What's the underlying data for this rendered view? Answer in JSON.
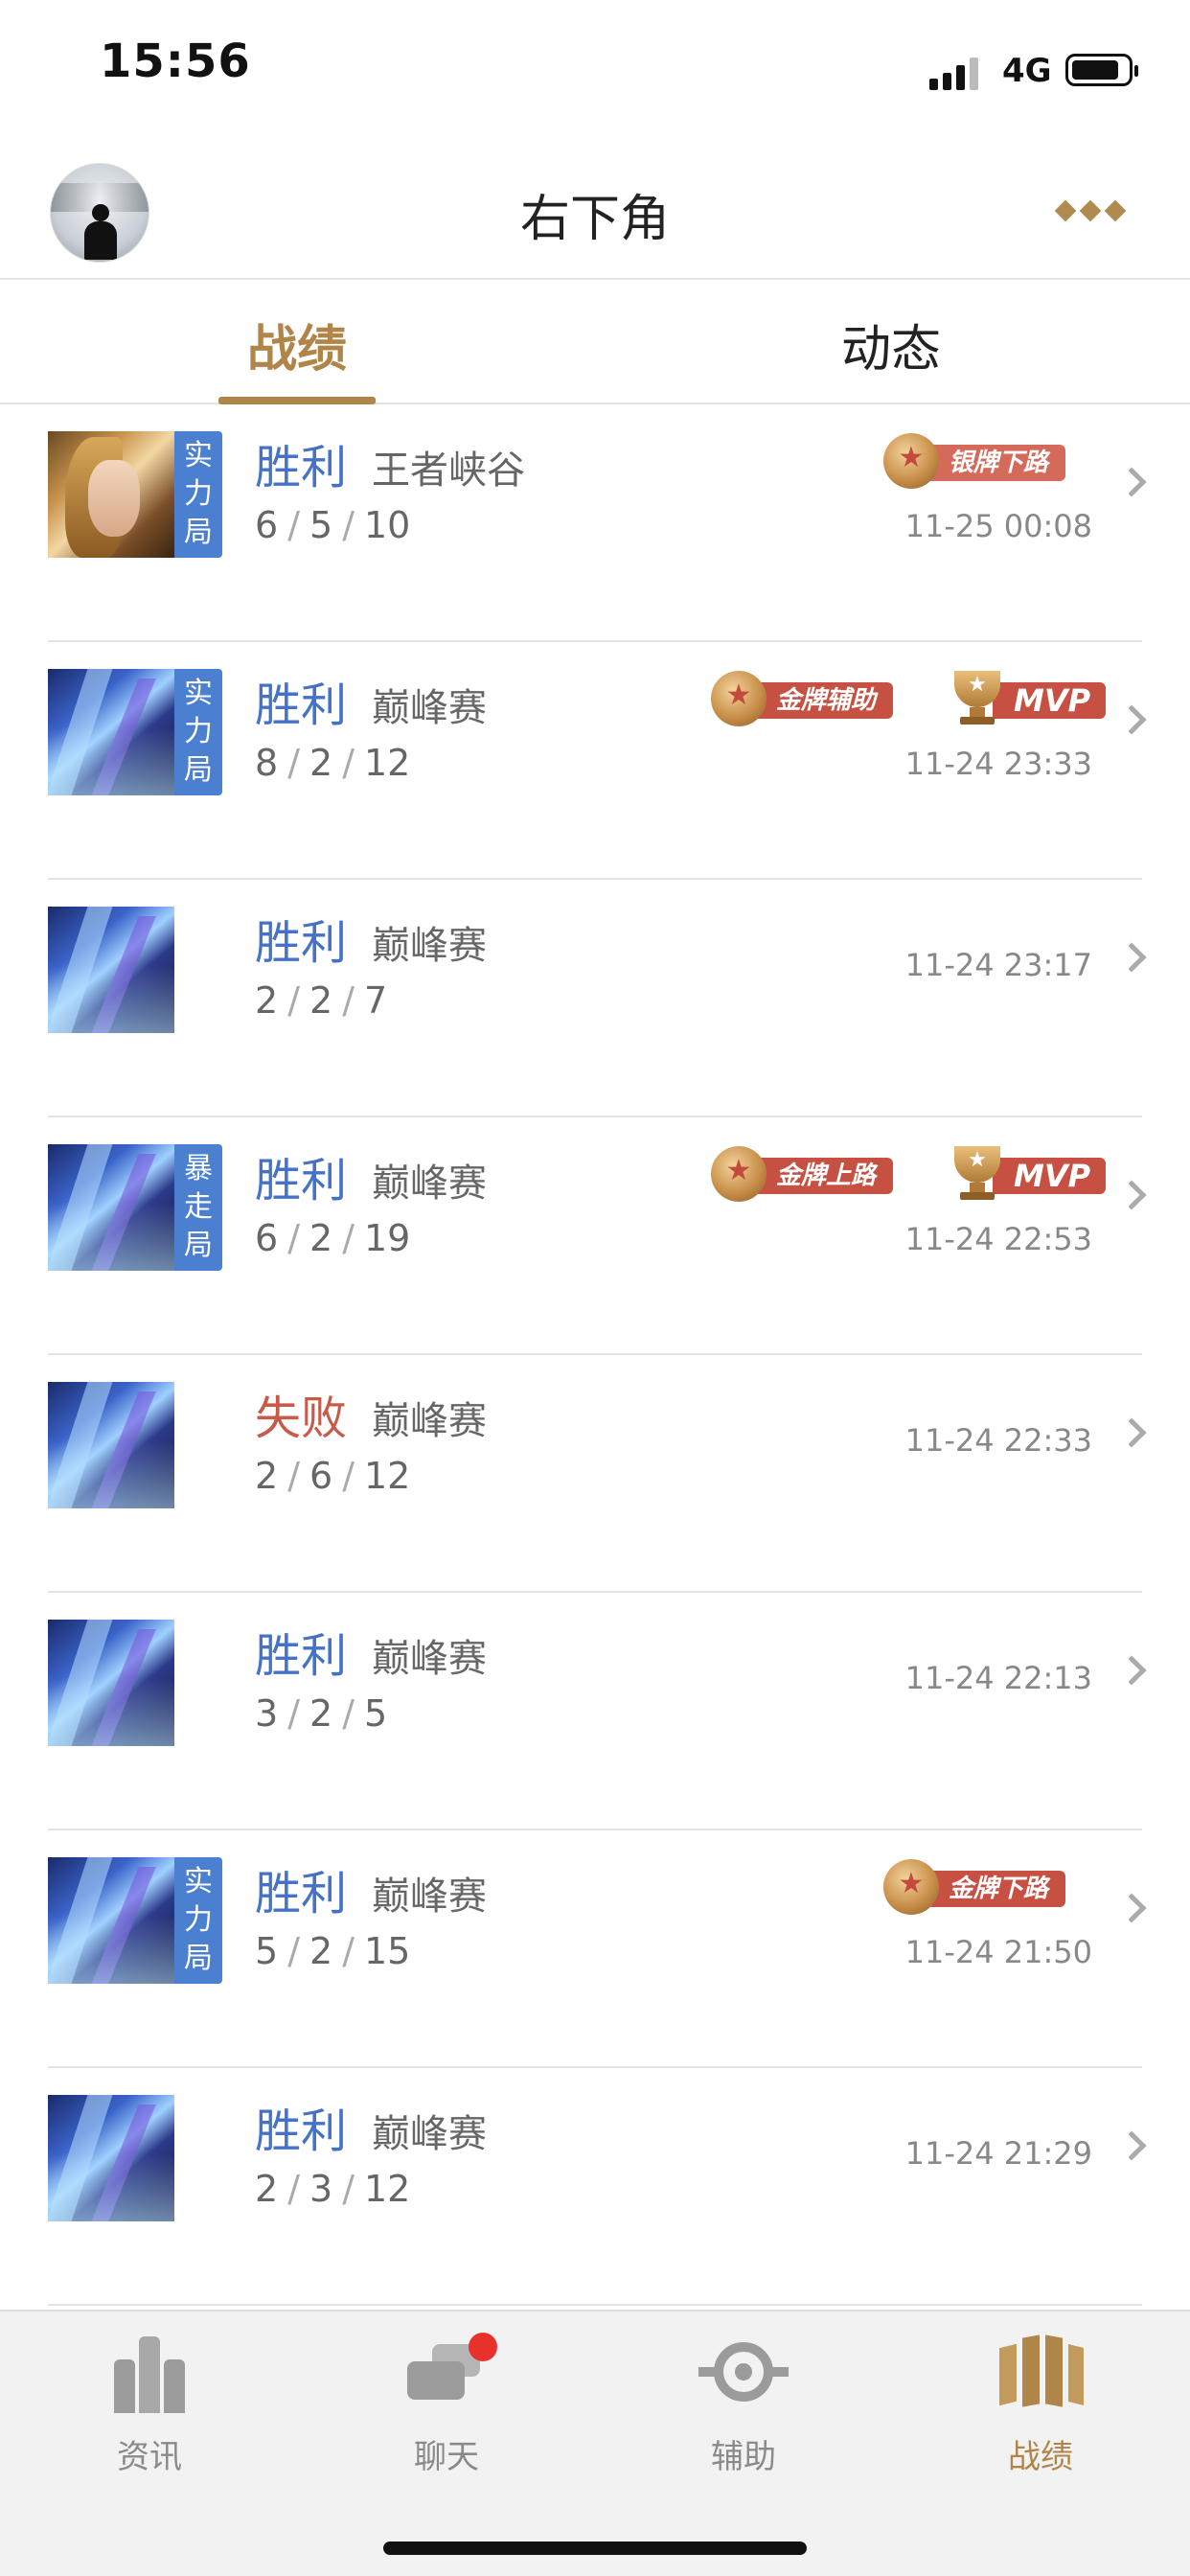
{
  "status_bar": {
    "time": "15:56",
    "network": "4G"
  },
  "header": {
    "title": "右下角"
  },
  "tabs": [
    {
      "label": "战绩",
      "active": true
    },
    {
      "label": "动态",
      "active": false
    }
  ],
  "matches": [
    {
      "result": "胜利",
      "mode": "王者峡谷",
      "k": "6",
      "d": "5",
      "a": "10",
      "time": "11-25 00:08",
      "tag": "实力局",
      "badges": [
        "银牌下路"
      ]
    },
    {
      "result": "胜利",
      "mode": "巅峰赛",
      "k": "8",
      "d": "2",
      "a": "12",
      "time": "11-24 23:33",
      "tag": "实力局",
      "badges": [
        "金牌辅助",
        "MVP"
      ]
    },
    {
      "result": "胜利",
      "mode": "巅峰赛",
      "k": "2",
      "d": "2",
      "a": "7",
      "time": "11-24 23:17",
      "tag": "",
      "badges": []
    },
    {
      "result": "胜利",
      "mode": "巅峰赛",
      "k": "6",
      "d": "2",
      "a": "19",
      "time": "11-24 22:53",
      "tag": "暴走局",
      "badges": [
        "金牌上路",
        "MVP"
      ]
    },
    {
      "result": "失败",
      "mode": "巅峰赛",
      "k": "2",
      "d": "6",
      "a": "12",
      "time": "11-24 22:33",
      "tag": "",
      "badges": []
    },
    {
      "result": "胜利",
      "mode": "巅峰赛",
      "k": "3",
      "d": "2",
      "a": "5",
      "time": "11-24 22:13",
      "tag": "",
      "badges": []
    },
    {
      "result": "胜利",
      "mode": "巅峰赛",
      "k": "5",
      "d": "2",
      "a": "15",
      "time": "11-24 21:50",
      "tag": "实力局",
      "badges": [
        "金牌下路"
      ]
    },
    {
      "result": "胜利",
      "mode": "巅峰赛",
      "k": "2",
      "d": "3",
      "a": "12",
      "time": "11-24 21:29",
      "tag": "",
      "badges": []
    }
  ],
  "bottom_nav": [
    {
      "label": "资讯",
      "icon": "news-icon",
      "active": false
    },
    {
      "label": "聊天",
      "icon": "chat-icon",
      "active": false,
      "has_dot": true
    },
    {
      "label": "辅助",
      "icon": "assist-icon",
      "active": false
    },
    {
      "label": "战绩",
      "icon": "record-icon",
      "active": true
    }
  ],
  "colors": {
    "accent": "#b08549",
    "win": "#4572c4",
    "lose": "#c85a49",
    "tag_bg": "#4b7fcf",
    "badge_red": "#c65142",
    "notify": "#e8312a"
  }
}
